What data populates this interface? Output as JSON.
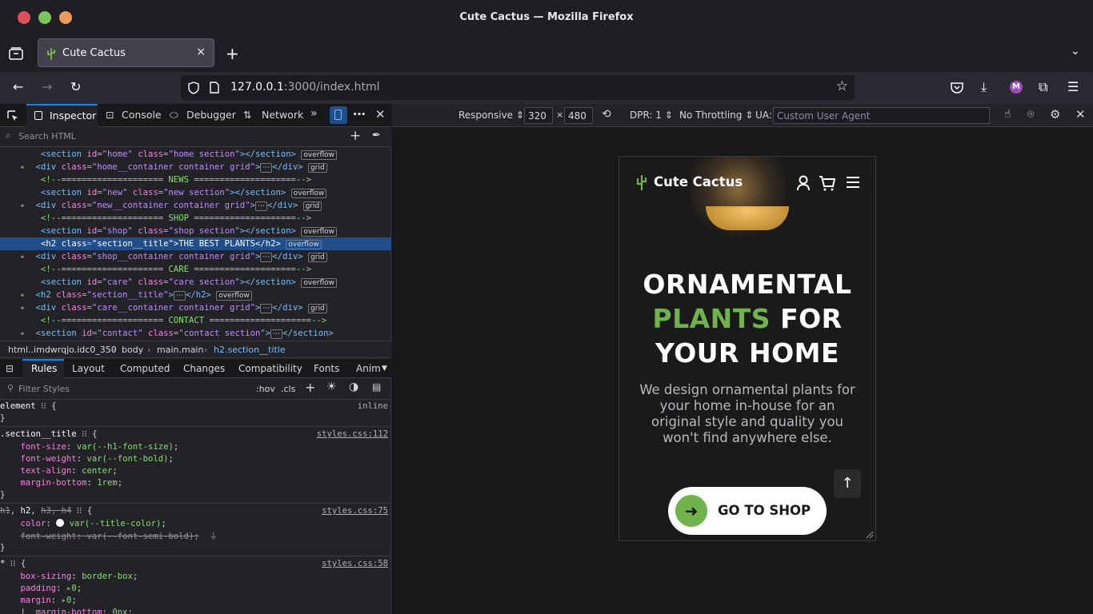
{
  "window": {
    "title": "Cute Cactus — Mozilla Firefox"
  },
  "tab": {
    "title": "Cute Cactus",
    "close": "×"
  },
  "new_tab": "+",
  "url": {
    "host": "127.0.0.1",
    "path": ":3000/index.html"
  },
  "devtools": {
    "tabs": [
      "Inspector",
      "Console",
      "Debugger",
      "Network"
    ],
    "search_placeholder": "Search HTML",
    "breadcrumbs": [
      "html..imdwrqjo.idc0_350",
      "body",
      "main.main",
      "h2.section__title"
    ],
    "rule_tabs": [
      "Rules",
      "Layout",
      "Computed",
      "Changes",
      "Compatibility",
      "Fonts",
      "Anim"
    ],
    "filter_placeholder": "Filter Styles",
    "filter_buttons": [
      ":hov",
      ".cls"
    ]
  },
  "tree": [
    {
      "t": "el",
      "open": "<section",
      "id": "home",
      "cls": "home section",
      "close": "></section>",
      "badge": "overflow"
    },
    {
      "t": "el2",
      "open": "<div",
      "cls": "home__container container grid",
      "close": "</div>",
      "badge": "grid"
    },
    {
      "t": "com",
      "text": "<!--==================== NEWS ====================-->"
    },
    {
      "t": "el",
      "open": "<section",
      "id": "new",
      "cls": "new section",
      "close": "></section>",
      "badge": "overflow"
    },
    {
      "t": "el2",
      "open": "<div",
      "cls": "new__container container grid",
      "close": "</div>",
      "badge": "grid"
    },
    {
      "t": "com",
      "text": "<!--==================== SHOP ====================-->"
    },
    {
      "t": "el",
      "open": "<section",
      "id": "shop",
      "cls": "shop section",
      "close": "></section>",
      "badge": "overflow"
    },
    {
      "t": "h2sel",
      "cls": "section__title",
      "text": "THE BEST PLANTS",
      "badge": "overflow"
    },
    {
      "t": "el2",
      "open": "<div",
      "cls": "shop__container container grid",
      "close": "</div>",
      "badge": "grid"
    },
    {
      "t": "com",
      "text": "<!--==================== CARE ====================-->"
    },
    {
      "t": "el",
      "open": "<section",
      "id": "care",
      "cls": "care section",
      "close": "></section>",
      "badge": "overflow"
    },
    {
      "t": "h2c",
      "cls": "section__title",
      "badge": "overflow"
    },
    {
      "t": "el2",
      "open": "<div",
      "cls": "care__container container grid",
      "close": "</div>",
      "badge": "grid"
    },
    {
      "t": "com",
      "text": "<!--==================== CONTACT ====================-->"
    },
    {
      "t": "sec2",
      "id": "contact",
      "cls": "contact section"
    }
  ],
  "rules": {
    "element": "element",
    "element_src": "inline",
    "r1": {
      "selector": ".section__title",
      "src": "styles.css:112",
      "decls": [
        [
          "font-size",
          "var(--h1-font-size)"
        ],
        [
          "font-weight",
          "var(--font-bold)"
        ],
        [
          "text-align",
          "center"
        ],
        [
          "margin-bottom",
          "1rem"
        ]
      ]
    },
    "r2": {
      "selector_struck": "h1",
      "selector": "h2",
      "selector_struck2": "h3, h4",
      "src": "styles.css:75",
      "decls": [
        [
          "color",
          "var(--title-color)"
        ]
      ],
      "struck": [
        "font-weight",
        "var(--font-semi-bold)"
      ]
    },
    "r3": {
      "selector": "*",
      "src": "styles.css:58",
      "decls": [
        [
          "box-sizing",
          "border-box"
        ],
        [
          "padding",
          "0"
        ],
        [
          "margin",
          "0"
        ]
      ],
      "sub": [
        "margin-bottom",
        "0px"
      ]
    }
  },
  "responsive": {
    "device": "Responsive",
    "width": "320",
    "times": "×",
    "height": "480",
    "dpr": "DPR: 1",
    "throttle": "No Throttling",
    "ua_label": "UA:",
    "ua_placeholder": "Custom User Agent"
  },
  "site": {
    "logo": "Cute Cactus",
    "headline_1": "ORNAMENTAL",
    "headline_green": "PLANTS",
    "headline_2": " FOR",
    "headline_3": "YOUR HOME",
    "description": "We design ornamental plants for your home in-house for an original style and quality you won't find anywhere else.",
    "cta": "GO TO SHOP"
  },
  "colors": {
    "accent_green": "#6fb34b",
    "selection_blue": "#204e8a"
  }
}
